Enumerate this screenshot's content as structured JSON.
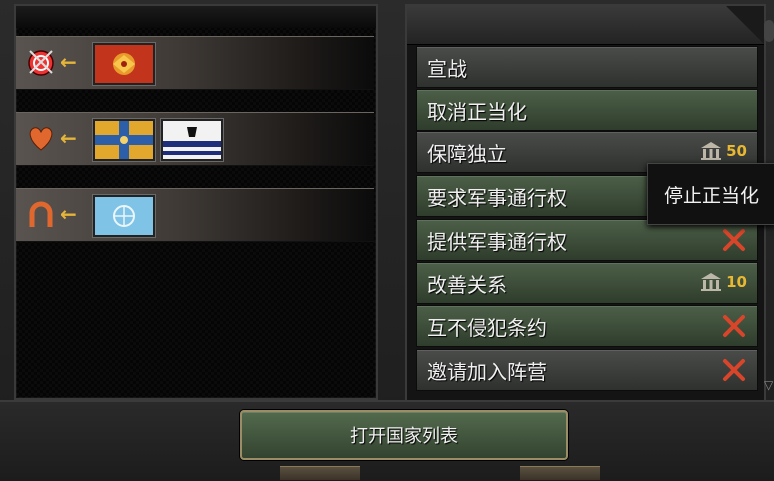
{
  "relations": [
    {
      "type": "attack-target",
      "flags": [
        "red-imperial-eagle-flag"
      ]
    },
    {
      "type": "favor",
      "flags": [
        "blue-yellow-cross-flag",
        "white-black-blue-flag"
      ]
    },
    {
      "type": "horseshoe",
      "flags": [
        "light-blue-globe-flag"
      ]
    }
  ],
  "actions": [
    {
      "label": "宣战",
      "style": "gray"
    },
    {
      "label": "取消正当化",
      "style": "green"
    },
    {
      "label": "保障独立",
      "style": "gray",
      "cost": "50"
    },
    {
      "label": "要求军事通行权",
      "style": "green"
    },
    {
      "label": "提供军事通行权",
      "style": "green",
      "blocked": true
    },
    {
      "label": "改善关系",
      "style": "green",
      "cost": "10"
    },
    {
      "label": "互不侵犯条约",
      "style": "green",
      "blocked": true
    },
    {
      "label": "邀请加入阵营",
      "style": "gray",
      "blocked": true
    }
  ],
  "tooltip": "停止正当化",
  "bottom_button": "打开国家列表",
  "colors": {
    "accent_gold": "#e8b832",
    "action_green": "#3e4f3a",
    "close_red": "#d9452a"
  }
}
